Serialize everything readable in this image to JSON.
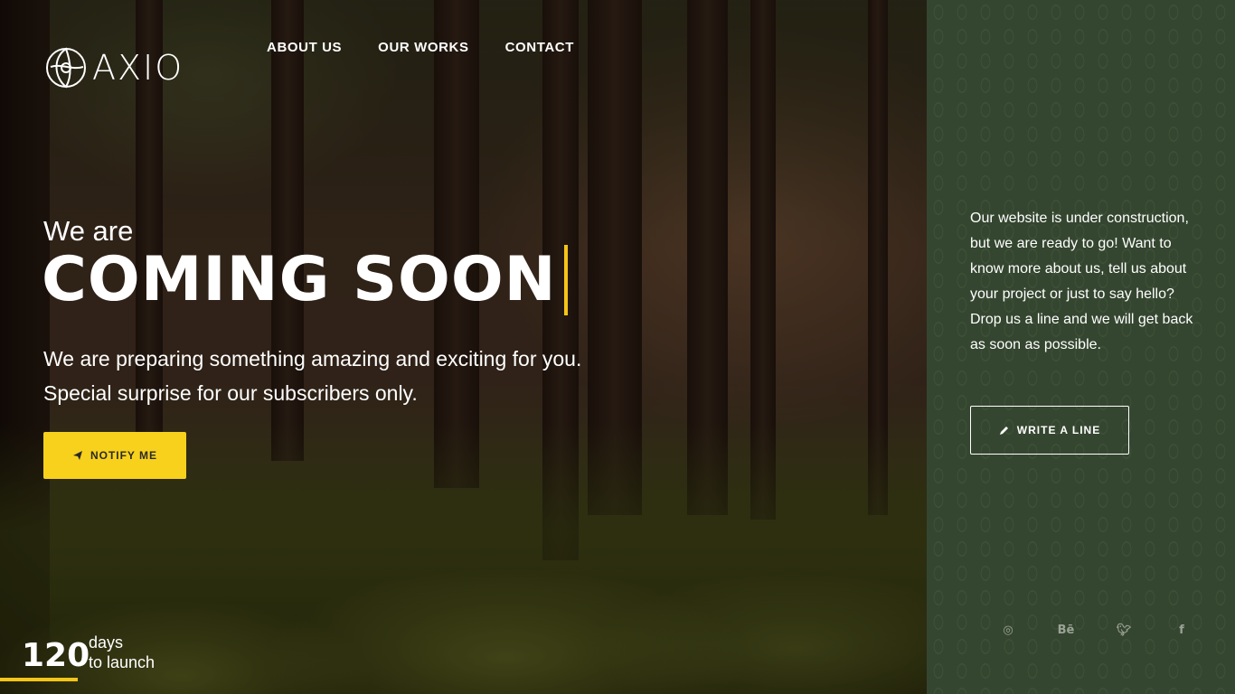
{
  "brand": {
    "name": "AXIO"
  },
  "nav": {
    "items": [
      "ABOUT US",
      "OUR WORKS",
      "CONTACT"
    ]
  },
  "hero": {
    "kicker": "We are",
    "title": "COMING SOON",
    "subtitle": "We are preparing something amazing and exciting for you. Special surprise for our subscribers only.",
    "cta_label": "NOTIFY ME",
    "cta_icon": "paper-plane-icon"
  },
  "countdown": {
    "number": "120",
    "line1": "days",
    "line2": "to launch"
  },
  "panel": {
    "text": "Our website is under construction, but we are ready to go! Want to know more about us, tell us about your project or just to say hello? Drop us a line and we will get back as soon as possible.",
    "button_label": "WRITE A LINE",
    "button_icon": "pencil-icon"
  },
  "social": [
    {
      "name": "dribbble-icon",
      "glyph": "◎"
    },
    {
      "name": "behance-icon",
      "glyph": "Bē"
    },
    {
      "name": "twitter-icon",
      "glyph": "🐦︎"
    },
    {
      "name": "facebook-icon",
      "glyph": "f"
    }
  ],
  "colors": {
    "accent": "#f7d11c",
    "panel": "#354630",
    "text": "#ffffff"
  }
}
